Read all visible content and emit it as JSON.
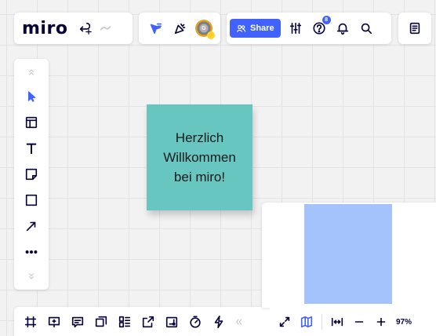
{
  "app": {
    "logo": "miro"
  },
  "toolbar": {
    "share_label": "Share",
    "help_badge": "8",
    "avatar_initial": "G"
  },
  "board": {
    "sticky_note": {
      "text": "Herzlich\nWillkommen\nbei miro!",
      "color": "#67c6c0"
    }
  },
  "left_tools": [
    {
      "icon": "collapse-up-icon"
    },
    {
      "icon": "select-cursor-icon",
      "active": true
    },
    {
      "icon": "templates-icon"
    },
    {
      "icon": "text-icon"
    },
    {
      "icon": "sticky-note-icon"
    },
    {
      "icon": "shape-icon"
    },
    {
      "icon": "connection-line-icon"
    },
    {
      "icon": "more-tools-icon"
    },
    {
      "icon": "expand-down-icon"
    }
  ],
  "zoom": {
    "level": "97%"
  },
  "colors": {
    "accent": "#4262ff",
    "sticky": "#67c6c0",
    "minimap_view": "#a4c2fb"
  }
}
